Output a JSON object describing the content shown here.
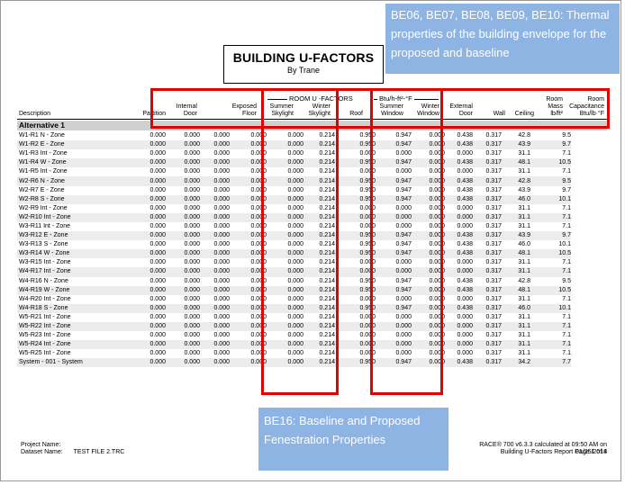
{
  "report": {
    "title": "BUILDING U-FACTORS",
    "subtitle": "By Trane"
  },
  "callouts": {
    "top": "BE06, BE07, BE08, BE09, BE10: Thermal properties of the building envelope for the proposed and baseline",
    "bottom": "BE16: Baseline and Proposed Fenestration Properties"
  },
  "groups": {
    "room": "ROOM U -FACTORS",
    "units": "Btu/h-ft²-°F"
  },
  "columns": {
    "description": "Description",
    "partition": "Partition",
    "internal_door_1": "Internal",
    "internal_door_2": "Door",
    "exposed_floor_1": "Exposed",
    "exposed_floor_2": "Floor",
    "summer_skylight_1": "Summer",
    "summer_skylight_2": "Skylight",
    "winter_skylight_1": "Winter",
    "winter_skylight_2": "Skylight",
    "roof": "Roof",
    "summer_window_1": "Summer",
    "summer_window_2": "Window",
    "winter_window_1": "Winter",
    "winter_window_2": "Window",
    "external_door_1": "External",
    "external_door_2": "Door",
    "wall": "Wall",
    "ceiling": "Ceiling",
    "room_mass_1": "Room",
    "room_mass_2": "Mass",
    "room_mass_3": "lb/ft²",
    "room_cap_1": "Room",
    "room_cap_2": "Capacitance",
    "room_cap_3": "Btu/lb·°F"
  },
  "section": "Alternative 1",
  "rows": [
    [
      "W1-R1 N - Zone",
      "0.000",
      "0.000",
      "0.000",
      "0.000",
      "0.000",
      "0.214",
      "0.950",
      "0.947",
      "0.000",
      "0.438",
      "0.317",
      "42.8",
      "9.5"
    ],
    [
      "W1-R2 E - Zone",
      "0.000",
      "0.000",
      "0.000",
      "0.000",
      "0.000",
      "0.214",
      "0.950",
      "0.947",
      "0.000",
      "0.438",
      "0.317",
      "43.9",
      "9.7"
    ],
    [
      "W1-R3 Int - Zone",
      "0.000",
      "0.000",
      "0.000",
      "0.000",
      "0.000",
      "0.214",
      "0.000",
      "0.000",
      "0.000",
      "0.000",
      "0.317",
      "31.1",
      "7.1"
    ],
    [
      "W1-R4 W - Zone",
      "0.000",
      "0.000",
      "0.000",
      "0.000",
      "0.000",
      "0.214",
      "0.950",
      "0.947",
      "0.000",
      "0.438",
      "0.317",
      "48.1",
      "10.5"
    ],
    [
      "W1-R5 Int - Zone",
      "0.000",
      "0.000",
      "0.000",
      "0.000",
      "0.000",
      "0.214",
      "0.000",
      "0.000",
      "0.000",
      "0.000",
      "0.317",
      "31.1",
      "7.1"
    ],
    [
      "W2-R6 N - Zone",
      "0.000",
      "0.000",
      "0.000",
      "0.000",
      "0.000",
      "0.214",
      "0.950",
      "0.947",
      "0.000",
      "0.438",
      "0.317",
      "42.8",
      "9.5"
    ],
    [
      "W2-R7 E - Zone",
      "0.000",
      "0.000",
      "0.000",
      "0.000",
      "0.000",
      "0.214",
      "0.950",
      "0.947",
      "0.000",
      "0.438",
      "0.317",
      "43.9",
      "9.7"
    ],
    [
      "W2-R8 S - Zone",
      "0.000",
      "0.000",
      "0.000",
      "0.000",
      "0.000",
      "0.214",
      "0.950",
      "0.947",
      "0.000",
      "0.438",
      "0.317",
      "46.0",
      "10.1"
    ],
    [
      "W2-R9 Int - Zone",
      "0.000",
      "0.000",
      "0.000",
      "0.000",
      "0.000",
      "0.214",
      "0.000",
      "0.000",
      "0.000",
      "0.000",
      "0.317",
      "31.1",
      "7.1"
    ],
    [
      "W2-R10 Int - Zone",
      "0.000",
      "0.000",
      "0.000",
      "0.000",
      "0.000",
      "0.214",
      "0.000",
      "0.000",
      "0.000",
      "0.000",
      "0.317",
      "31.1",
      "7.1"
    ],
    [
      "W3-R11 Int - Zone",
      "0.000",
      "0.000",
      "0.000",
      "0.000",
      "0.000",
      "0.214",
      "0.000",
      "0.000",
      "0.000",
      "0.000",
      "0.317",
      "31.1",
      "7.1"
    ],
    [
      "W3-R12 E - Zone",
      "0.000",
      "0.000",
      "0.000",
      "0.000",
      "0.000",
      "0.214",
      "0.950",
      "0.947",
      "0.000",
      "0.438",
      "0.317",
      "43.9",
      "9.7"
    ],
    [
      "W3-R13 S - Zone",
      "0.000",
      "0.000",
      "0.000",
      "0.000",
      "0.000",
      "0.214",
      "0.950",
      "0.947",
      "0.000",
      "0.438",
      "0.317",
      "46.0",
      "10.1"
    ],
    [
      "W3-R14 W - Zone",
      "0.000",
      "0.000",
      "0.000",
      "0.000",
      "0.000",
      "0.214",
      "0.950",
      "0.947",
      "0.000",
      "0.438",
      "0.317",
      "48.1",
      "10.5"
    ],
    [
      "W3-R15 Int - Zone",
      "0.000",
      "0.000",
      "0.000",
      "0.000",
      "0.000",
      "0.214",
      "0.000",
      "0.000",
      "0.000",
      "0.000",
      "0.317",
      "31.1",
      "7.1"
    ],
    [
      "W4-R17 Int - Zone",
      "0.000",
      "0.000",
      "0.000",
      "0.000",
      "0.000",
      "0.214",
      "0.000",
      "0.000",
      "0.000",
      "0.000",
      "0.317",
      "31.1",
      "7.1"
    ],
    [
      "W4-R16 N - Zone",
      "0.000",
      "0.000",
      "0.000",
      "0.000",
      "0.000",
      "0.214",
      "0.950",
      "0.947",
      "0.000",
      "0.438",
      "0.317",
      "42.8",
      "9.5"
    ],
    [
      "W4-R19 W - Zone",
      "0.000",
      "0.000",
      "0.000",
      "0.000",
      "0.000",
      "0.214",
      "0.950",
      "0.947",
      "0.000",
      "0.438",
      "0.317",
      "48.1",
      "10.5"
    ],
    [
      "W4-R20 Int - Zone",
      "0.000",
      "0.000",
      "0.000",
      "0.000",
      "0.000",
      "0.214",
      "0.000",
      "0.000",
      "0.000",
      "0.000",
      "0.317",
      "31.1",
      "7.1"
    ],
    [
      "W4-R18 S - Zone",
      "0.000",
      "0.000",
      "0.000",
      "0.000",
      "0.000",
      "0.214",
      "0.950",
      "0.947",
      "0.000",
      "0.438",
      "0.317",
      "46.0",
      "10.1"
    ],
    [
      "W5-R21 Int - Zone",
      "0.000",
      "0.000",
      "0.000",
      "0.000",
      "0.000",
      "0.214",
      "0.000",
      "0.000",
      "0.000",
      "0.000",
      "0.317",
      "31.1",
      "7.1"
    ],
    [
      "W5-R22 Int - Zone",
      "0.000",
      "0.000",
      "0.000",
      "0.000",
      "0.000",
      "0.214",
      "0.000",
      "0.000",
      "0.000",
      "0.000",
      "0.317",
      "31.1",
      "7.1"
    ],
    [
      "W5-R23 Int - Zone",
      "0.000",
      "0.000",
      "0.000",
      "0.000",
      "0.000",
      "0.214",
      "0.000",
      "0.000",
      "0.000",
      "0.000",
      "0.317",
      "31.1",
      "7.1"
    ],
    [
      "W5-R24 Int - Zone",
      "0.000",
      "0.000",
      "0.000",
      "0.000",
      "0.000",
      "0.214",
      "0.000",
      "0.000",
      "0.000",
      "0.000",
      "0.317",
      "31.1",
      "7.1"
    ],
    [
      "W5-R25 Int - Zone",
      "0.000",
      "0.000",
      "0.000",
      "0.000",
      "0.000",
      "0.214",
      "0.000",
      "0.000",
      "0.000",
      "0.000",
      "0.317",
      "31.1",
      "7.1"
    ],
    [
      "System - 001 - System",
      "0.000",
      "0.000",
      "0.000",
      "0.000",
      "0.000",
      "0.214",
      "0.950",
      "0.947",
      "0.000",
      "0.438",
      "0.317",
      "34.2",
      "7.7"
    ]
  ],
  "footer": {
    "project_label": "Project Name:",
    "project_value": "",
    "dataset_label": "Dataset Name:",
    "dataset_value": "TEST FILE 2.TRC",
    "calc_line": "RACE® 700 v6.3.3 calculated at 09:50 AM on 01/25/2018",
    "report_line": "Building U-Factors Report Page 1 of 4"
  }
}
